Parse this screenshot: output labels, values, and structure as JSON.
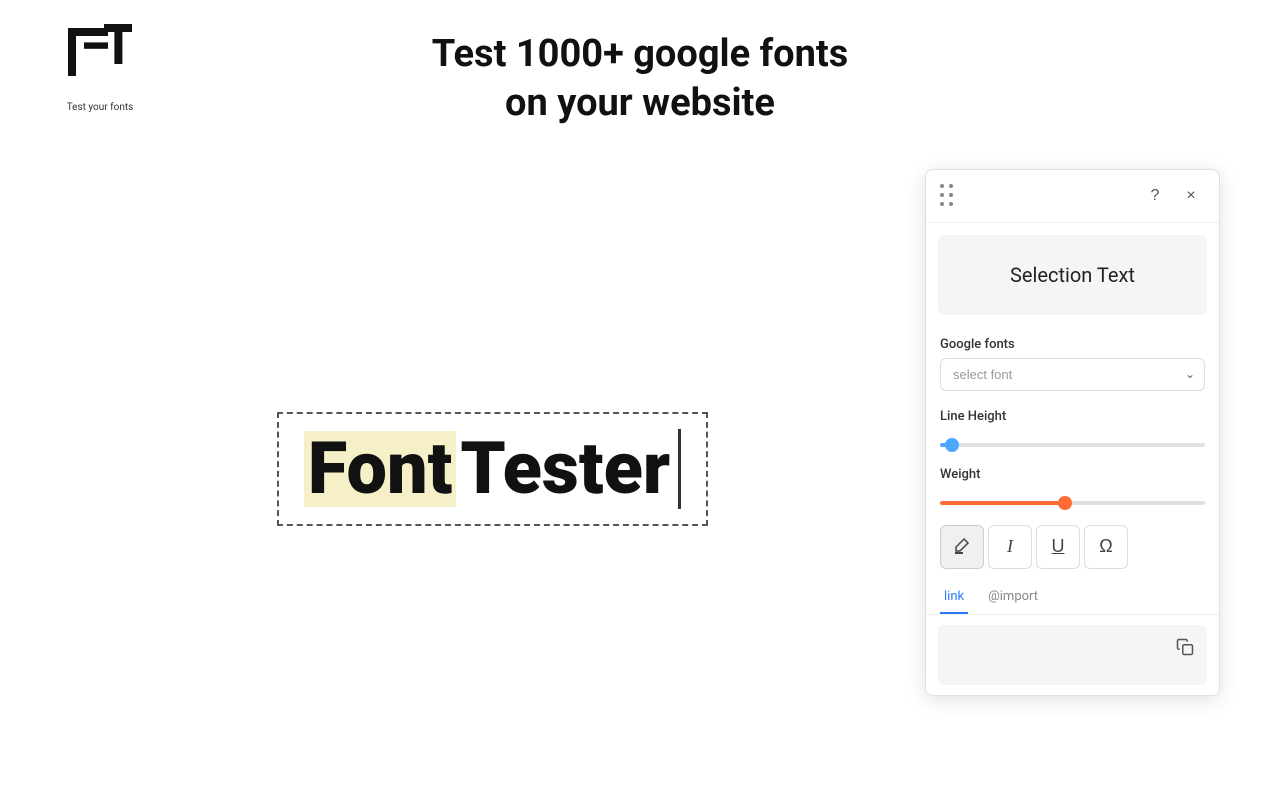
{
  "header": {
    "title_line1": "Test 1000+ google fonts",
    "title_line2": "on your website",
    "logo_tagline": "Test your fonts"
  },
  "canvas": {
    "text_part1": "Font",
    "text_part2": " Tester"
  },
  "panel": {
    "selection_text_label": "Selection Text",
    "google_fonts_label": "Google fonts",
    "font_select_placeholder": "select font",
    "line_height_label": "Line Height",
    "weight_label": "Weight",
    "line_height_value": 2,
    "weight_value": 47,
    "tabs": [
      {
        "id": "link",
        "label": "link",
        "active": true
      },
      {
        "id": "import",
        "label": "@import",
        "active": false
      }
    ],
    "style_buttons": [
      {
        "id": "highlight",
        "symbol": "🖊",
        "label": "highlight-button",
        "active": true
      },
      {
        "id": "italic",
        "symbol": "I",
        "label": "italic-button",
        "active": false
      },
      {
        "id": "underline",
        "symbol": "U",
        "label": "underline-button",
        "active": false
      },
      {
        "id": "omega",
        "symbol": "Ω",
        "label": "omega-button",
        "active": false
      }
    ],
    "close_label": "×",
    "help_label": "?"
  }
}
